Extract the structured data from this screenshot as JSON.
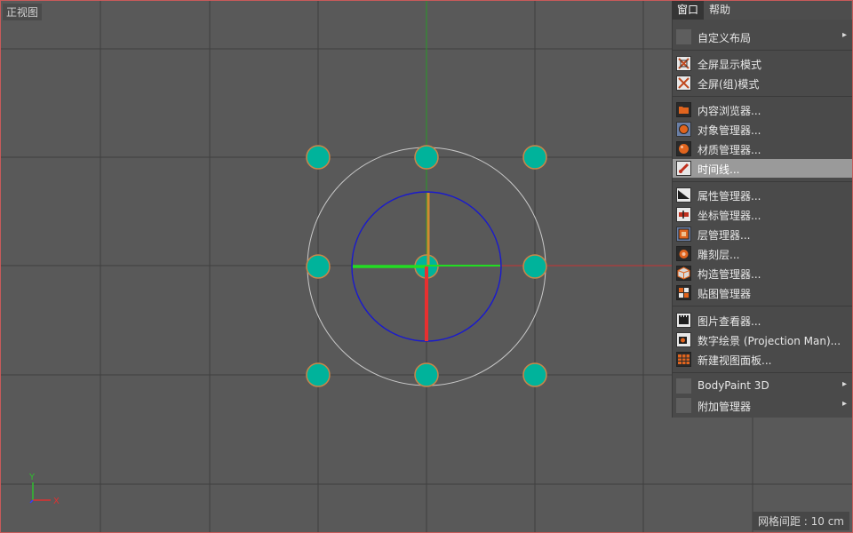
{
  "viewport": {
    "view_name": "正视图",
    "grid_distance": "网格间距 : 10 cm",
    "axis_x_label": "X",
    "axis_y_label": "Y"
  },
  "menubar": {
    "items": [
      "窗口",
      "帮助"
    ],
    "active": "窗口"
  },
  "window_menu": {
    "items": [
      {
        "label": "自定义布局",
        "icon": "blank-icon",
        "submenu": true
      },
      {
        "label": "全屏显示模式",
        "icon": "fullscreen-icon"
      },
      {
        "label": "全屏(组)模式",
        "icon": "fullscreen-group-icon"
      },
      {
        "label": "内容浏览器...",
        "icon": "content-browser-icon"
      },
      {
        "label": "对象管理器...",
        "icon": "object-manager-icon"
      },
      {
        "label": "材质管理器...",
        "icon": "material-manager-icon"
      },
      {
        "label": "时间线...",
        "icon": "timeline-icon",
        "highlighted": true
      },
      {
        "label": "属性管理器...",
        "icon": "attribute-manager-icon"
      },
      {
        "label": "坐标管理器...",
        "icon": "coordinate-manager-icon"
      },
      {
        "label": "层管理器...",
        "icon": "layer-manager-icon"
      },
      {
        "label": "雕刻层...",
        "icon": "sculpt-layer-icon"
      },
      {
        "label": "构造管理器...",
        "icon": "structure-manager-icon"
      },
      {
        "label": "贴图管理器",
        "icon": "texture-manager-icon"
      },
      {
        "label": "图片查看器...",
        "icon": "picture-viewer-icon"
      },
      {
        "label": "数字绘景 (Projection Man)...",
        "icon": "projection-man-icon"
      },
      {
        "label": "新建视图面板...",
        "icon": "new-view-panel-icon"
      },
      {
        "label": "BodyPaint 3D",
        "icon": "blank-icon",
        "submenu": true
      },
      {
        "label": "附加管理器",
        "icon": "blank-icon",
        "submenu": true
      }
    ],
    "submenu_arrow": "▸"
  },
  "colors": {
    "viewport_bg": "#595959",
    "grid_line": "#404040",
    "y_axis": "#2f8f2f",
    "x_axis": "#c83232",
    "handle_fill": "#00b39b",
    "handle_stroke": "#c8864a",
    "blue_circle": "#1a1acc",
    "menu_highlight": "#9a9a9a"
  }
}
